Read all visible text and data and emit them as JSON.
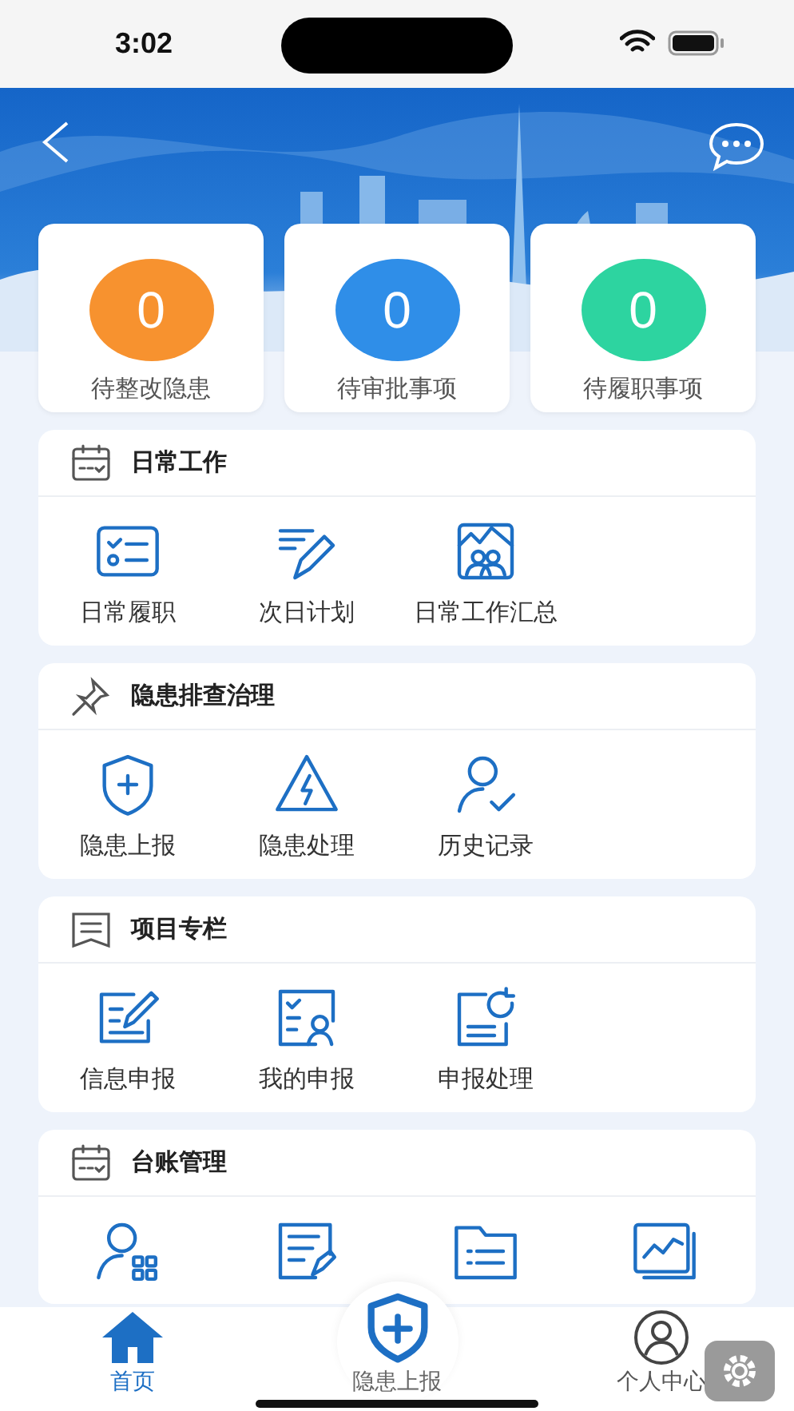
{
  "status_bar": {
    "time": "3:02"
  },
  "stats": [
    {
      "count": "0",
      "label": "待整改隐患",
      "color": "#f7922f"
    },
    {
      "count": "0",
      "label": "待审批事项",
      "color": "#2f8ee8"
    },
    {
      "count": "0",
      "label": "待履职事项",
      "color": "#2dd4a0"
    }
  ],
  "sections": [
    {
      "title": "日常工作",
      "items": [
        {
          "kind": "shortcut",
          "label": "日常履职"
        },
        {
          "kind": "shortcut",
          "label": "次日计划"
        },
        {
          "kind": "shortcut",
          "label": "日常工作汇总"
        }
      ]
    },
    {
      "title": "隐患排查治理",
      "items": [
        {
          "kind": "shortcut",
          "label": "隐患上报"
        },
        {
          "kind": "shortcut",
          "label": "隐患处理"
        },
        {
          "kind": "shortcut",
          "label": "历史记录"
        }
      ]
    },
    {
      "title": "项目专栏",
      "items": [
        {
          "kind": "shortcut",
          "label": "信息申报"
        },
        {
          "kind": "shortcut",
          "label": "我的申报"
        },
        {
          "kind": "shortcut",
          "label": "申报处理"
        }
      ]
    },
    {
      "title": "台账管理",
      "items": [
        {
          "kind": "shortcut"
        },
        {
          "kind": "shortcut"
        },
        {
          "kind": "shortcut"
        },
        {
          "kind": "shortcut"
        }
      ]
    }
  ],
  "tab_bar": [
    {
      "kind": "tab",
      "label": "首页",
      "selected": true
    },
    {
      "kind": "center",
      "label": "隐患上报"
    },
    {
      "kind": "tab",
      "label": "个人中心",
      "selected": false
    }
  ]
}
